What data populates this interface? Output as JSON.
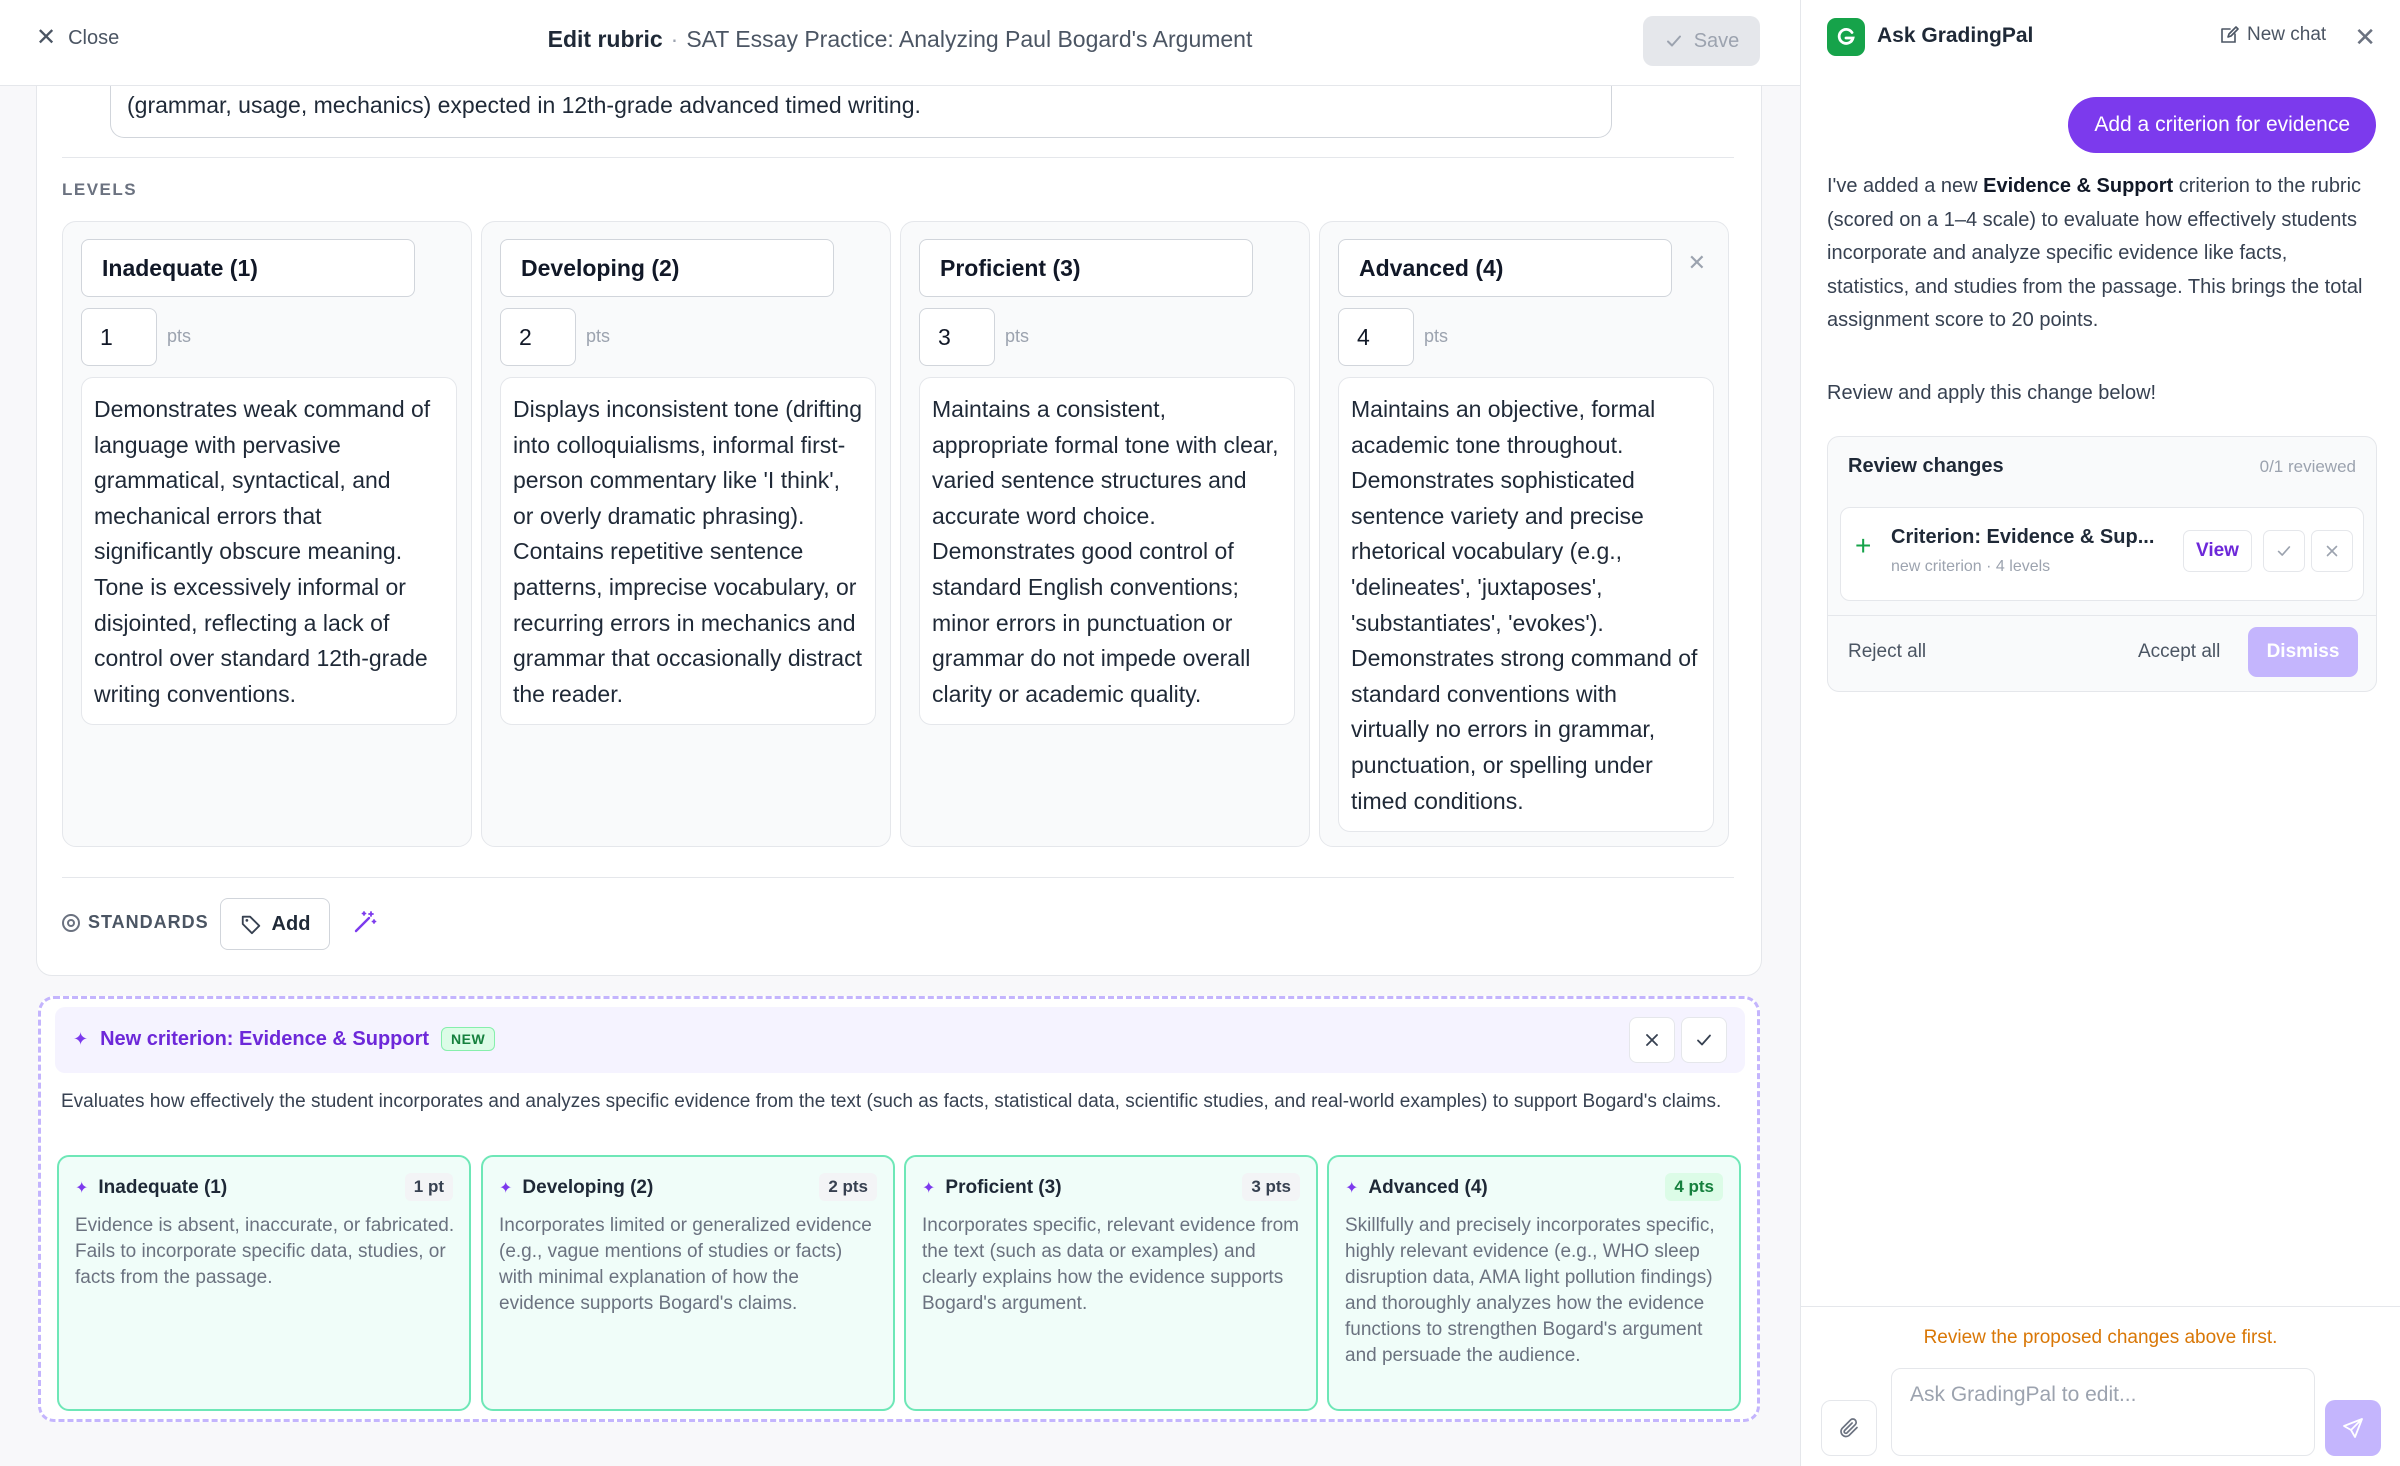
{
  "header": {
    "close_label": "Close",
    "title_bold": "Edit rubric",
    "separator": "·",
    "title_assignment": "SAT Essay Practice: Analyzing Paul Bogard's Argument",
    "save_label": "Save"
  },
  "criterion": {
    "description_tail": "(grammar, usage, mechanics) expected in 12th-grade advanced timed writing.",
    "levels_label": "LEVELS",
    "pts_label": "pts",
    "levels": [
      {
        "name": "Inadequate (1)",
        "points": "1",
        "description": "Demonstrates weak command of language with pervasive grammatical, syntactical, and mechanical errors that significantly obscure meaning. Tone is excessively informal or disjointed, reflecting a lack of control over standard 12th-grade writing conventions."
      },
      {
        "name": "Developing (2)",
        "points": "2",
        "description": "Displays inconsistent tone (drifting into colloquialisms, informal first-person commentary like 'I think', or overly dramatic phrasing). Contains repetitive sentence patterns, imprecise vocabulary, or recurring errors in mechanics and grammar that occasionally distract the reader."
      },
      {
        "name": "Proficient (3)",
        "points": "3",
        "description": "Maintains a consistent, appropriate formal tone with clear, varied sentence structures and accurate word choice. Demonstrates good control of standard English conventions; minor errors in punctuation or grammar do not impede overall clarity or academic quality."
      },
      {
        "name": "Advanced (4)",
        "points": "4",
        "description": "Maintains an objective, formal academic tone throughout. Demonstrates sophisticated sentence variety and precise rhetorical vocabulary (e.g., 'delineates', 'juxtaposes', 'substantiates', 'evokes'). Demonstrates strong command of standard conventions with virtually no errors in grammar, punctuation, or spelling under timed conditions."
      }
    ],
    "standards_label": "STANDARDS",
    "add_label": "Add"
  },
  "proposal": {
    "title": "New criterion: Evidence & Support",
    "badge": "NEW",
    "description": "Evaluates how effectively the student incorporates and analyzes specific evidence from the text (such as facts, statistical data, scientific studies, and real-world examples) to support Bogard's claims.",
    "levels": [
      {
        "name": "Inadequate (1)",
        "points": "1 pt",
        "description": "Evidence is absent, inaccurate, or fabricated. Fails to incorporate specific data, studies, or facts from the passage."
      },
      {
        "name": "Developing (2)",
        "points": "2 pts",
        "description": "Incorporates limited or generalized evidence (e.g., vague mentions of studies or facts) with minimal explanation of how the evidence supports Bogard's claims."
      },
      {
        "name": "Proficient (3)",
        "points": "3 pts",
        "description": "Incorporates specific, relevant evidence from the text (such as data or examples) and clearly explains how the evidence supports Bogard's argument."
      },
      {
        "name": "Advanced (4)",
        "points": "4 pts",
        "description": "Skillfully and precisely incorporates specific, highly relevant evidence (e.g., WHO sleep disruption data, AMA light pollution findings) and thoroughly analyzes how the evidence functions to strengthen Bogard's argument and persuade the audience."
      }
    ]
  },
  "chat": {
    "title": "Ask GradingPal",
    "new_chat_label": "New chat",
    "user_message": "Add a criterion for evidence",
    "ai_intro": "I've added a new ",
    "ai_bold": "Evidence & Support",
    "ai_rest": " criterion to the rubric (scored on a 1–4 scale) to evaluate how effectively students incorporate and analyze specific evidence like facts, statistics, and studies from the passage. This brings the total assignment score to 20 points.",
    "ai_followup": "Review and apply this change below!",
    "review": {
      "title": "Review changes",
      "count": "0/1 reviewed",
      "item_name": "Criterion: Evidence & Sup...",
      "item_sub": "new criterion · 4 levels",
      "view_label": "View",
      "reject_all": "Reject all",
      "accept_all": "Accept all",
      "dismiss": "Dismiss"
    },
    "warning": "Review the proposed changes above first.",
    "input_placeholder": "Ask GradingPal to edit..."
  },
  "colors": {
    "accent": "#7c3aed",
    "accent_light": "#c4b5fd",
    "success": "#16a34a",
    "warning": "#d97706"
  }
}
